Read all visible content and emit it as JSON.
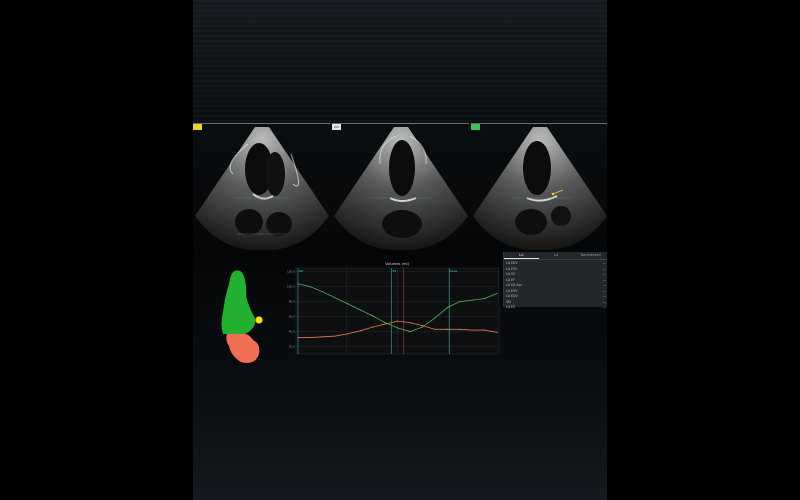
{
  "views": [
    {
      "tag": "",
      "tag_color": "#f2d02a"
    },
    {
      "tag": "2ch",
      "tag_color": "#e6e6e6"
    },
    {
      "tag": "",
      "tag_color": "#39c45a"
    }
  ],
  "chart_data": {
    "type": "line",
    "title": "Volumes (ml)",
    "markers": [
      {
        "label": "ED",
        "x": 0.0
      },
      {
        "label": "ES",
        "x": 0.47
      },
      {
        "label": "Peak",
        "x": 0.76
      }
    ],
    "y_ticks": [
      "120.0",
      "100.0",
      "80.0",
      "60.0",
      "40.0",
      "20.0"
    ],
    "ylim": [
      10,
      125
    ],
    "series": [
      {
        "color": "#4fb253",
        "values": [
          104,
          100,
          93,
          85,
          77,
          69,
          61,
          52,
          45,
          40,
          46,
          58,
          72,
          80,
          82,
          84,
          91
        ]
      },
      {
        "color": "#e07a52",
        "values": [
          32,
          32,
          33,
          34,
          37,
          41,
          46,
          50,
          54,
          52,
          48,
          43,
          43,
          43,
          42,
          42,
          39
        ]
      }
    ]
  },
  "panel": {
    "tabs": [
      "LA",
      "LA",
      "Normalized"
    ],
    "rows": [
      {
        "label": "LA EDV",
        "value": "..."
      },
      {
        "label": "LA ESV",
        "value": "..."
      },
      {
        "label": "LA SV",
        "value": "..."
      },
      {
        "label": "LA EF",
        "value": "..."
      },
      {
        "label": "LA ED Apl",
        "value": "..."
      },
      {
        "label": "LA ESV",
        "value": "..."
      },
      {
        "label": "LA EDV",
        "value": "..."
      },
      {
        "label": "SM",
        "value": "..."
      },
      {
        "label": "LA ES",
        "value": "..."
      }
    ]
  }
}
